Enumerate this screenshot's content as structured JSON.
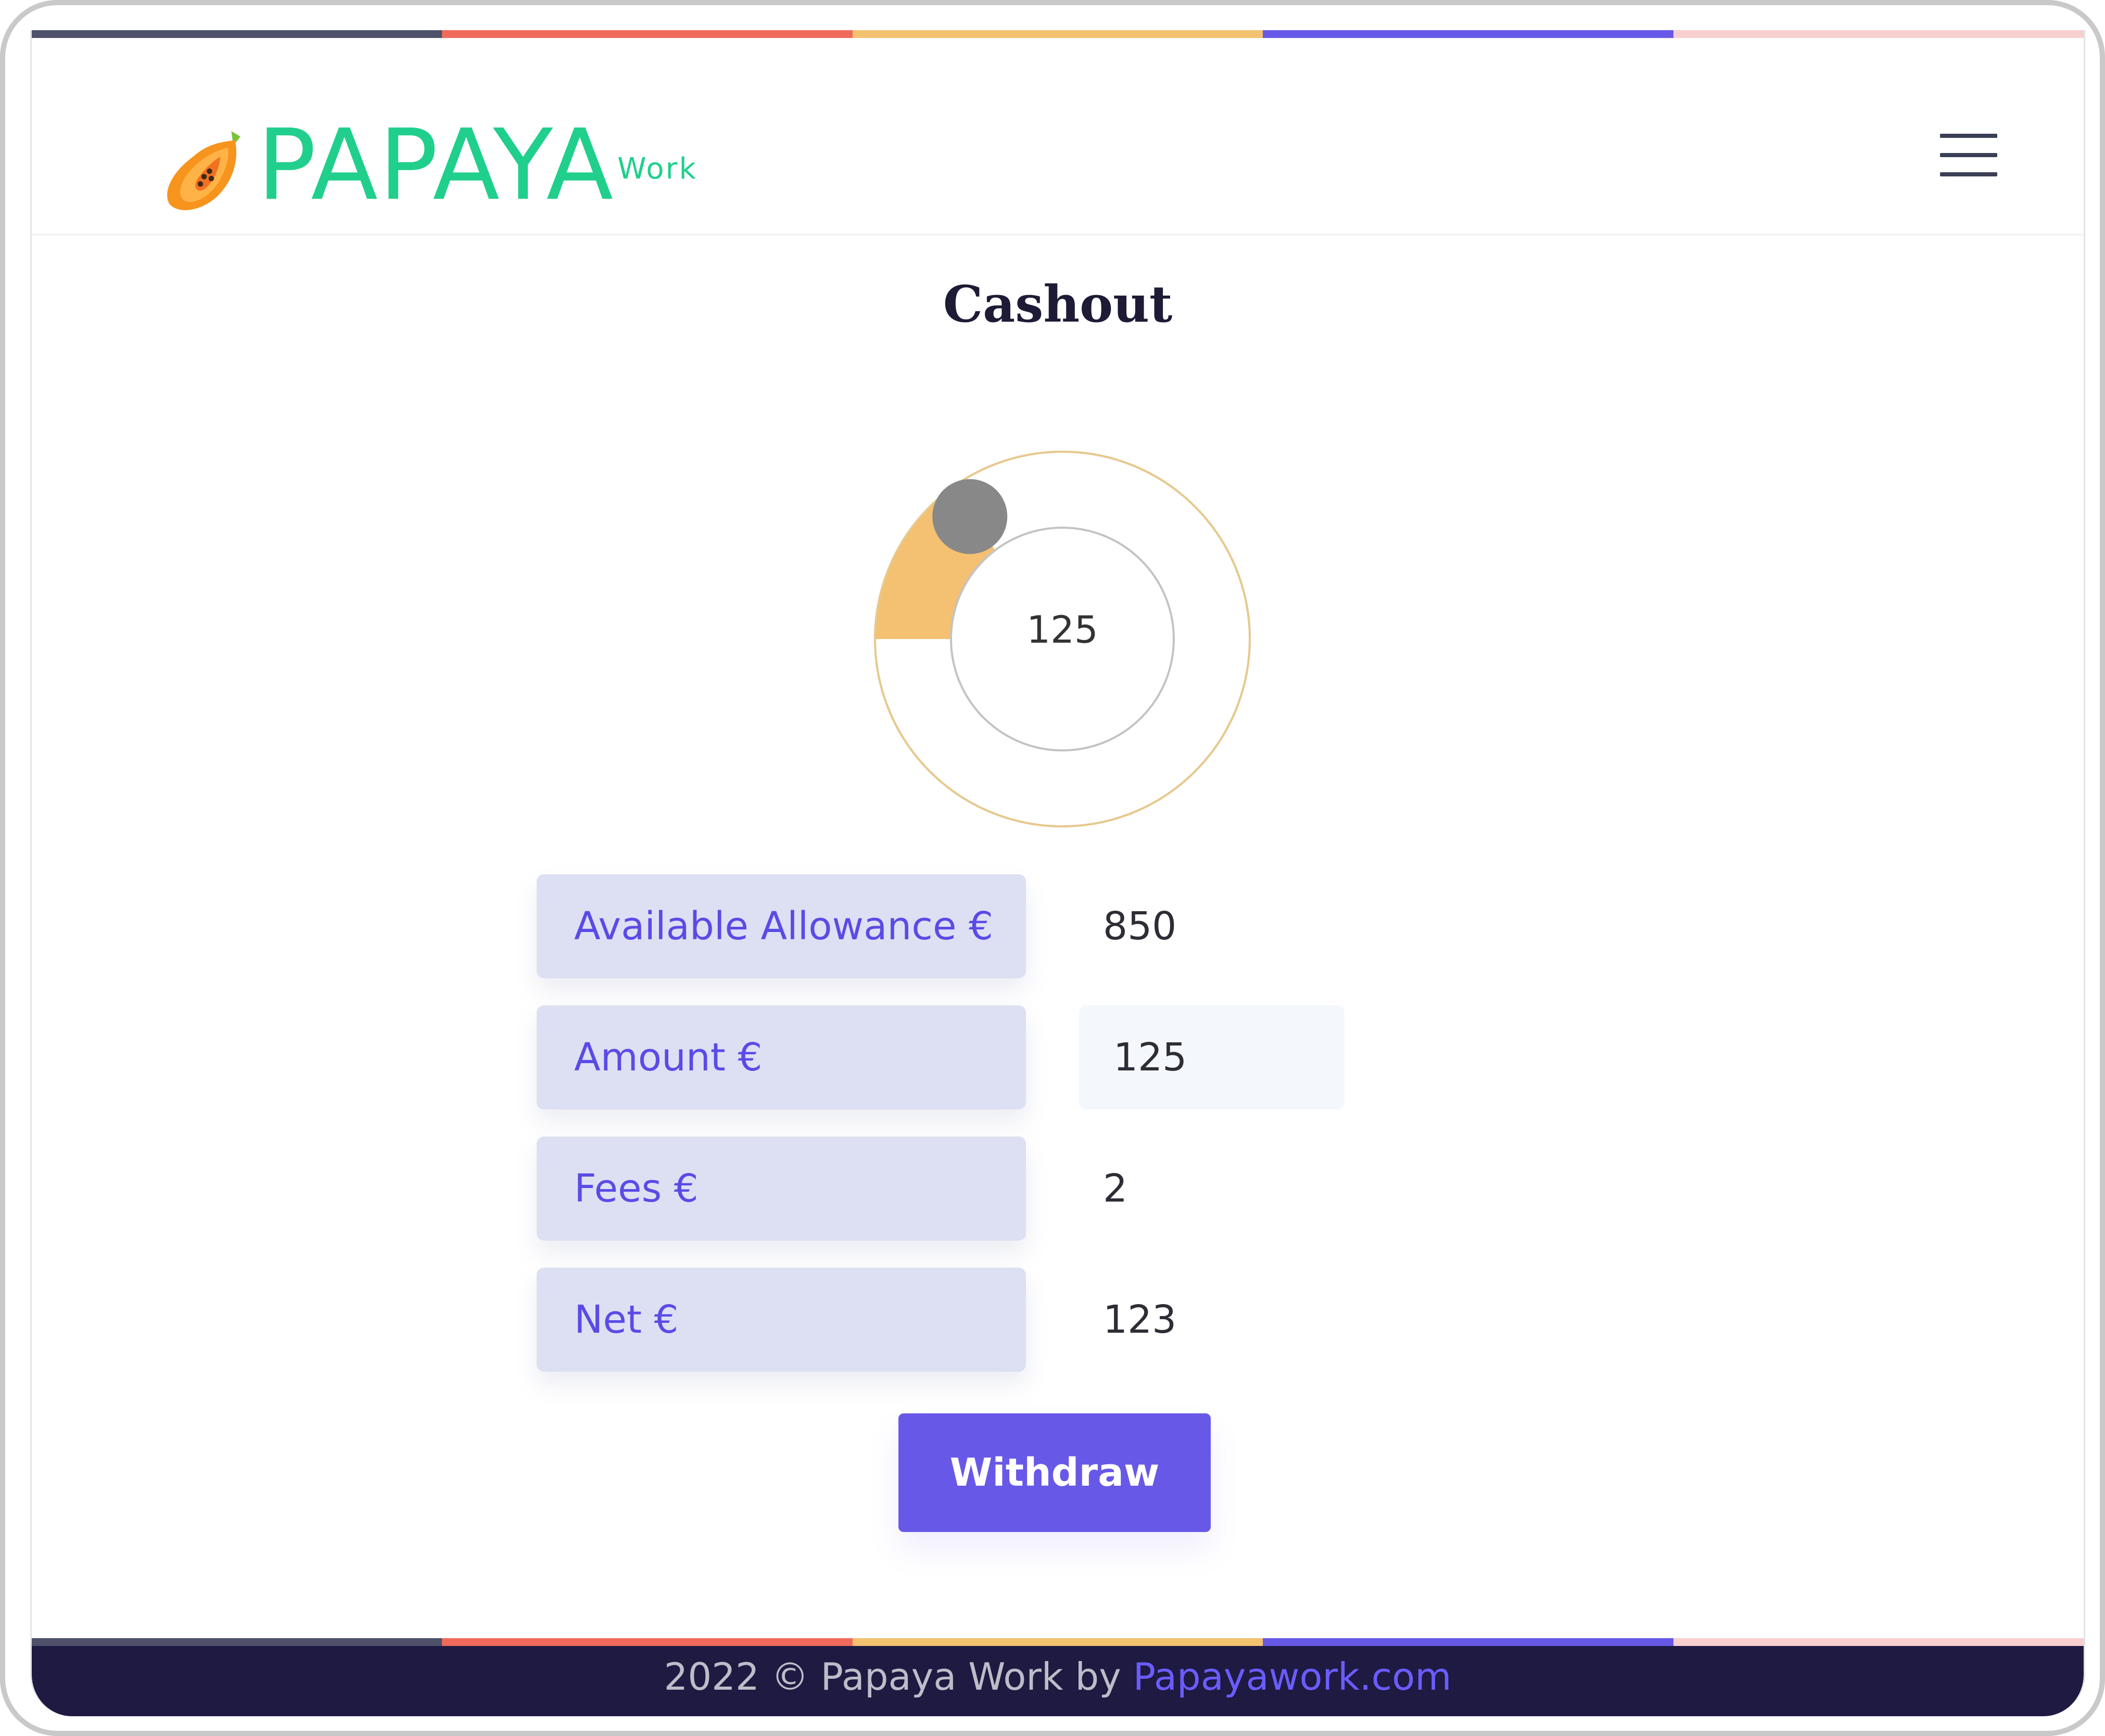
{
  "brand": {
    "name": "PAPAYA",
    "sub": "Work",
    "color": "#21cf8c"
  },
  "header": {
    "menu_icon": "hamburger-menu-icon"
  },
  "stripe_colors": [
    "#4e5169",
    "#f06a5c",
    "#f3c26f",
    "#6858e8",
    "#f8cfcf"
  ],
  "page": {
    "title": "Cashout"
  },
  "gauge": {
    "value": 125,
    "max": 850,
    "display": "125",
    "fill_color": "#f4c071",
    "handle_color": "#888888"
  },
  "rows": [
    {
      "label": "Available Allowance €",
      "value": "850"
    },
    {
      "label": "Amount €",
      "value": "125"
    },
    {
      "label": "Fees €",
      "value": "2"
    },
    {
      "label": "Net €",
      "value": "123"
    }
  ],
  "actions": {
    "withdraw_label": "Withdraw",
    "accent": "#6858e8"
  },
  "footer": {
    "text": "2022 © Papaya Work by ",
    "link": "Papayawork.com"
  }
}
